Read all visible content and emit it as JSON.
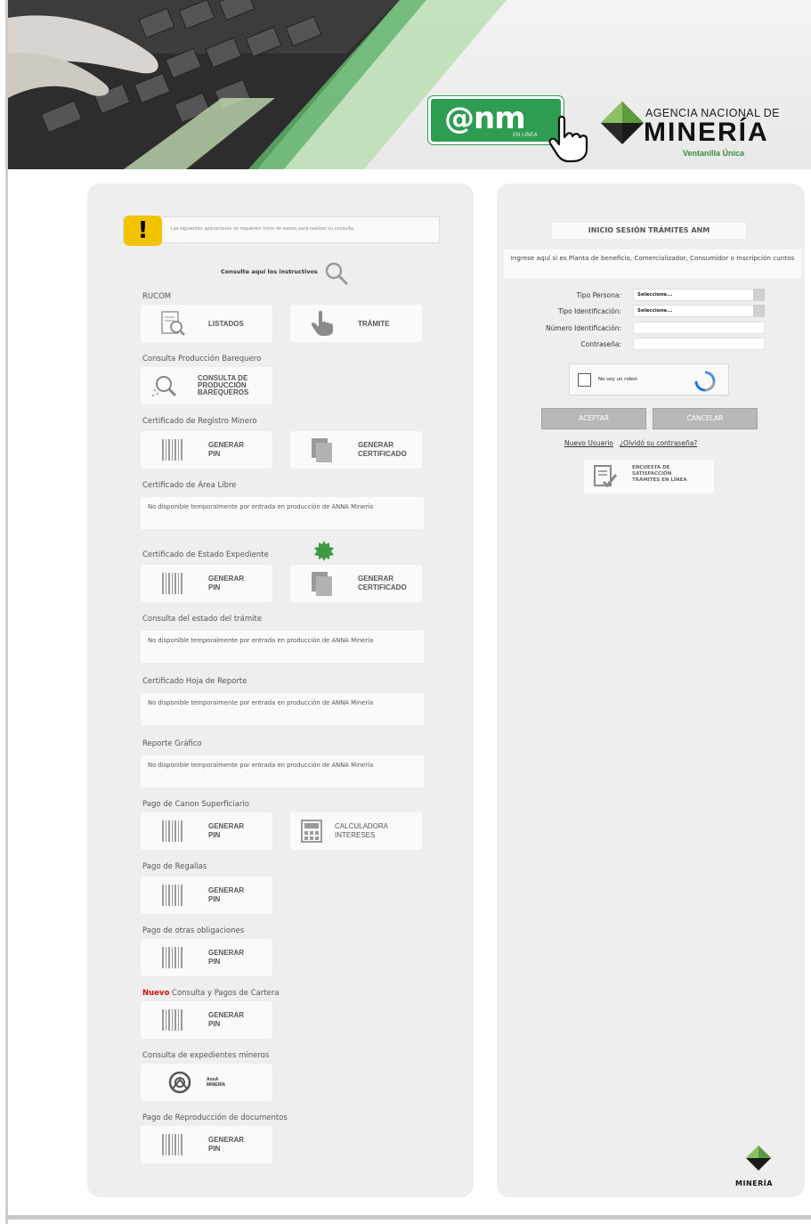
{
  "header": {
    "anm_button": "@nm",
    "anm_sub": "EN LINEA",
    "agency_top": "AGENCIA NACIONAL DE",
    "agency_main": "MINERÍA",
    "agency_sub": "Ventanilla Única"
  },
  "notice": "Las siguientes aplicaciones no requieren inicio de sesión para realizar su consulta.",
  "instructions": "Consulte aquí los instructivos",
  "sections": [
    {
      "title": "RUCOM",
      "tiles": [
        "LISTADOS",
        "TRÁMITE"
      ]
    },
    {
      "title": "Consulta Producción Barequero",
      "tiles": [
        "CONSULTA DE\nPRODUCCIÓN\nBAREQUEROS"
      ]
    },
    {
      "title": "Certificado de Registro Minero",
      "tiles": [
        "GENERAR\nPIN",
        "GENERAR\nCERTIFICADO"
      ]
    },
    {
      "title": "Certificado de Área Libre",
      "message": "No disponible temporalmente por entrada en producción de ANNA Minería"
    },
    {
      "title": "Certificado de Estado Expediente",
      "tiles": [
        "GENERAR\nPIN",
        "GENERAR\nCERTIFICADO"
      ]
    },
    {
      "title": "Consulta del estado del trámite",
      "message": "No disponible temporalmente por entrada en producción de ANNA Minería"
    },
    {
      "title": "Certificado Hoja de Reporte",
      "message": "No disponible temporalmente por entrada en producción de ANNA Minería"
    },
    {
      "title": "Reporte Gráfico",
      "message": "No disponible temporalmente por entrada en producción de ANNA Minería"
    },
    {
      "title": "Pago de Canon Superficiario",
      "tiles": [
        "GENERAR\nPIN",
        "CALCULADORA\nINTERESES"
      ]
    },
    {
      "title": "Pago de Regalías",
      "tiles": [
        "GENERAR\nPIN"
      ]
    },
    {
      "title": "Pago de otras obligaciones",
      "tiles": [
        "GENERAR\nPIN"
      ]
    },
    {
      "title_new": "Nuevo",
      "title": "Consulta y Pagos de Cartera",
      "tiles": [
        "GENERAR\nPIN"
      ]
    },
    {
      "title": "Consulta de expedientes mineros",
      "tiles": [
        "AnnA\nMINERÍA"
      ]
    },
    {
      "title": "Pago de Reproducción de documentos",
      "tiles": [
        "GENERAR\nPIN"
      ]
    }
  ],
  "login": {
    "title": "INICIO SESIÓN TRÁMITES ANM",
    "intro": "Ingrese aquí si es Planta de beneficio, Comercializador, Consumidor o Inscripción cuntos",
    "labels": {
      "tipo_persona": "Tipo Persona:",
      "tipo_identificacion": "Tipo Identificación:",
      "numero_identificacion": "Número Identificación:",
      "contrasena": "Contraseña:"
    },
    "values": {
      "tipo_persona": "Seleccione...",
      "tipo_identificacion": "Seleccione..."
    },
    "captcha": "No soy un robot",
    "accept": "ACEPTAR",
    "cancel": "CANCELAR",
    "new_user": "Nuevo Usuario",
    "forgot": "¿Olvidó su contraseña?",
    "survey": "ENCUESTA DE\nSATISFACCIÓN\nTRÁMITES EN LÍNEA"
  },
  "footer_logo": "MINERÍA"
}
